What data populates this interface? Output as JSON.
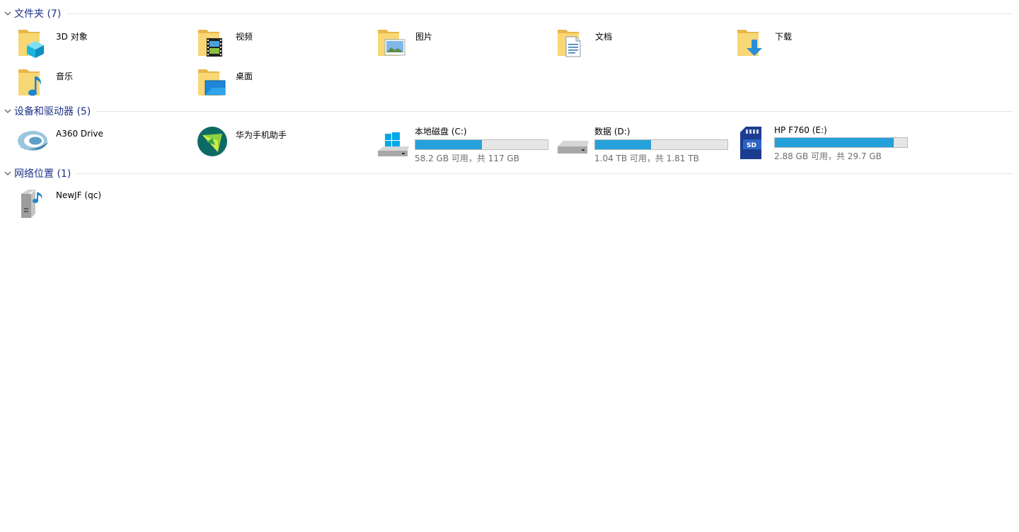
{
  "groups": {
    "folders": {
      "title": "文件夹 (7)"
    },
    "devices": {
      "title": "设备和驱动器 (5)"
    },
    "network": {
      "title": "网络位置 (1)"
    }
  },
  "folders": [
    {
      "label": "3D 对象",
      "icon": "3d-objects-folder-icon"
    },
    {
      "label": "视频",
      "icon": "videos-folder-icon"
    },
    {
      "label": "图片",
      "icon": "pictures-folder-icon"
    },
    {
      "label": "文档",
      "icon": "documents-folder-icon"
    },
    {
      "label": "下载",
      "icon": "downloads-folder-icon"
    },
    {
      "label": "音乐",
      "icon": "music-folder-icon"
    },
    {
      "label": "桌面",
      "icon": "desktop-folder-icon"
    }
  ],
  "devices": [
    {
      "label": "A360 Drive",
      "icon": "a360-drive-icon"
    },
    {
      "label": "华为手机助手",
      "icon": "huawei-hisuite-icon"
    },
    {
      "label": "本地磁盘 (C:)",
      "icon": "windows-drive-icon",
      "free": "58.2 GB 可用，共 117 GB",
      "used_fraction": 0.5
    },
    {
      "label": "数据 (D:)",
      "icon": "hard-drive-icon",
      "free": "1.04 TB 可用，共 1.81 TB",
      "used_fraction": 0.42
    },
    {
      "label": "HP F760 (E:)",
      "icon": "sd-card-icon",
      "free": "2.88 GB 可用，共 29.7 GB",
      "used_fraction": 0.9
    }
  ],
  "network": [
    {
      "label": "NewJF (qc)",
      "icon": "network-media-server-icon"
    }
  ],
  "colors": {
    "group_title": "#1e3287",
    "usage_bar": "#26a0da",
    "folder": "#f8d775"
  }
}
